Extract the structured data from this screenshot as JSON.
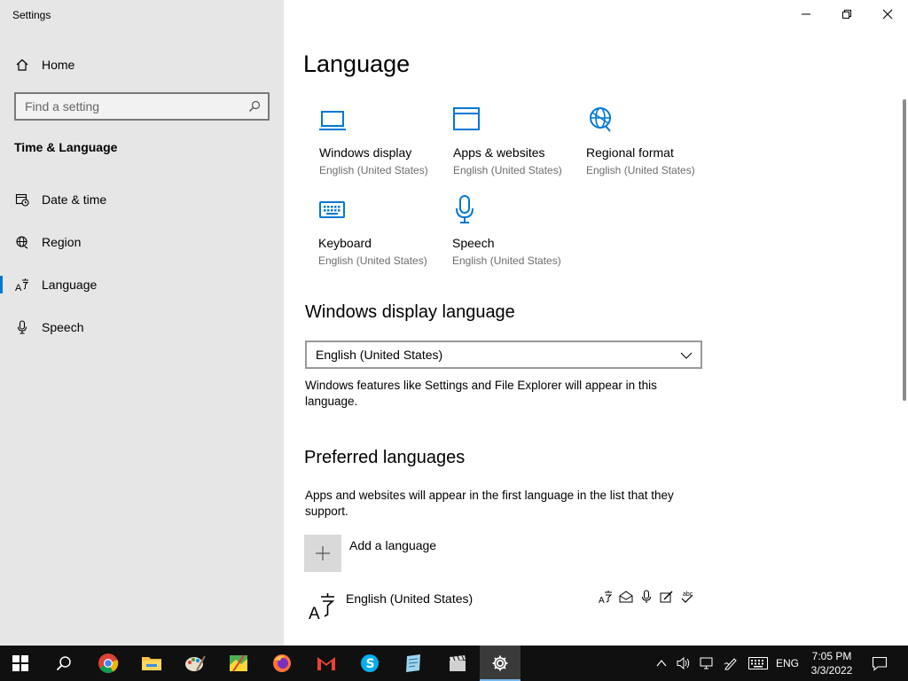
{
  "window": {
    "title": "Settings"
  },
  "sidebar": {
    "home_label": "Home",
    "search_placeholder": "Find a setting",
    "section_heading": "Time & Language",
    "items": [
      {
        "label": "Date & time",
        "icon": "calendar-clock-icon"
      },
      {
        "label": "Region",
        "icon": "globe-icon"
      },
      {
        "label": "Language",
        "icon": "language-icon",
        "active": true
      },
      {
        "label": "Speech",
        "icon": "microphone-icon"
      }
    ]
  },
  "main": {
    "title": "Language",
    "tiles": [
      {
        "name": "Windows display",
        "sub": "English (United States)",
        "icon": "monitor-icon"
      },
      {
        "name": "Apps & websites",
        "sub": "English (United States)",
        "icon": "browser-window-icon"
      },
      {
        "name": "Regional format",
        "sub": "English (United States)",
        "icon": "globe-gear-icon"
      },
      {
        "name": "Keyboard",
        "sub": "English (United States)",
        "icon": "keyboard-icon"
      },
      {
        "name": "Speech",
        "sub": "English (United States)",
        "icon": "microphone-icon"
      }
    ],
    "display_language": {
      "heading": "Windows display language",
      "selected": "English (United States)",
      "description": "Windows features like Settings and File Explorer will appear in this language."
    },
    "preferred": {
      "heading": "Preferred languages",
      "description": "Apps and websites will appear in the first language in the list that they support.",
      "add_label": "Add a language",
      "languages": [
        {
          "name": "English (United States)",
          "features": [
            "display-language-icon",
            "text-to-speech-icon",
            "speech-recognition-icon",
            "handwriting-icon",
            "spell-check-icon"
          ]
        }
      ]
    }
  },
  "taskbar": {
    "apps": [
      "start-icon",
      "search-icon",
      "chrome-icon",
      "file-explorer-icon",
      "paint-icon",
      "maps-icon",
      "firefox-icon",
      "gmail-icon",
      "skype-icon",
      "notepad-icon",
      "video-editor-icon",
      "settings-icon"
    ],
    "tray": {
      "language": "ENG",
      "time": "7:05 PM",
      "date": "3/3/2022"
    }
  },
  "colors": {
    "accent": "#0078d7",
    "sidebar_bg": "#e6e6e6",
    "taskbar_bg": "#101010"
  }
}
